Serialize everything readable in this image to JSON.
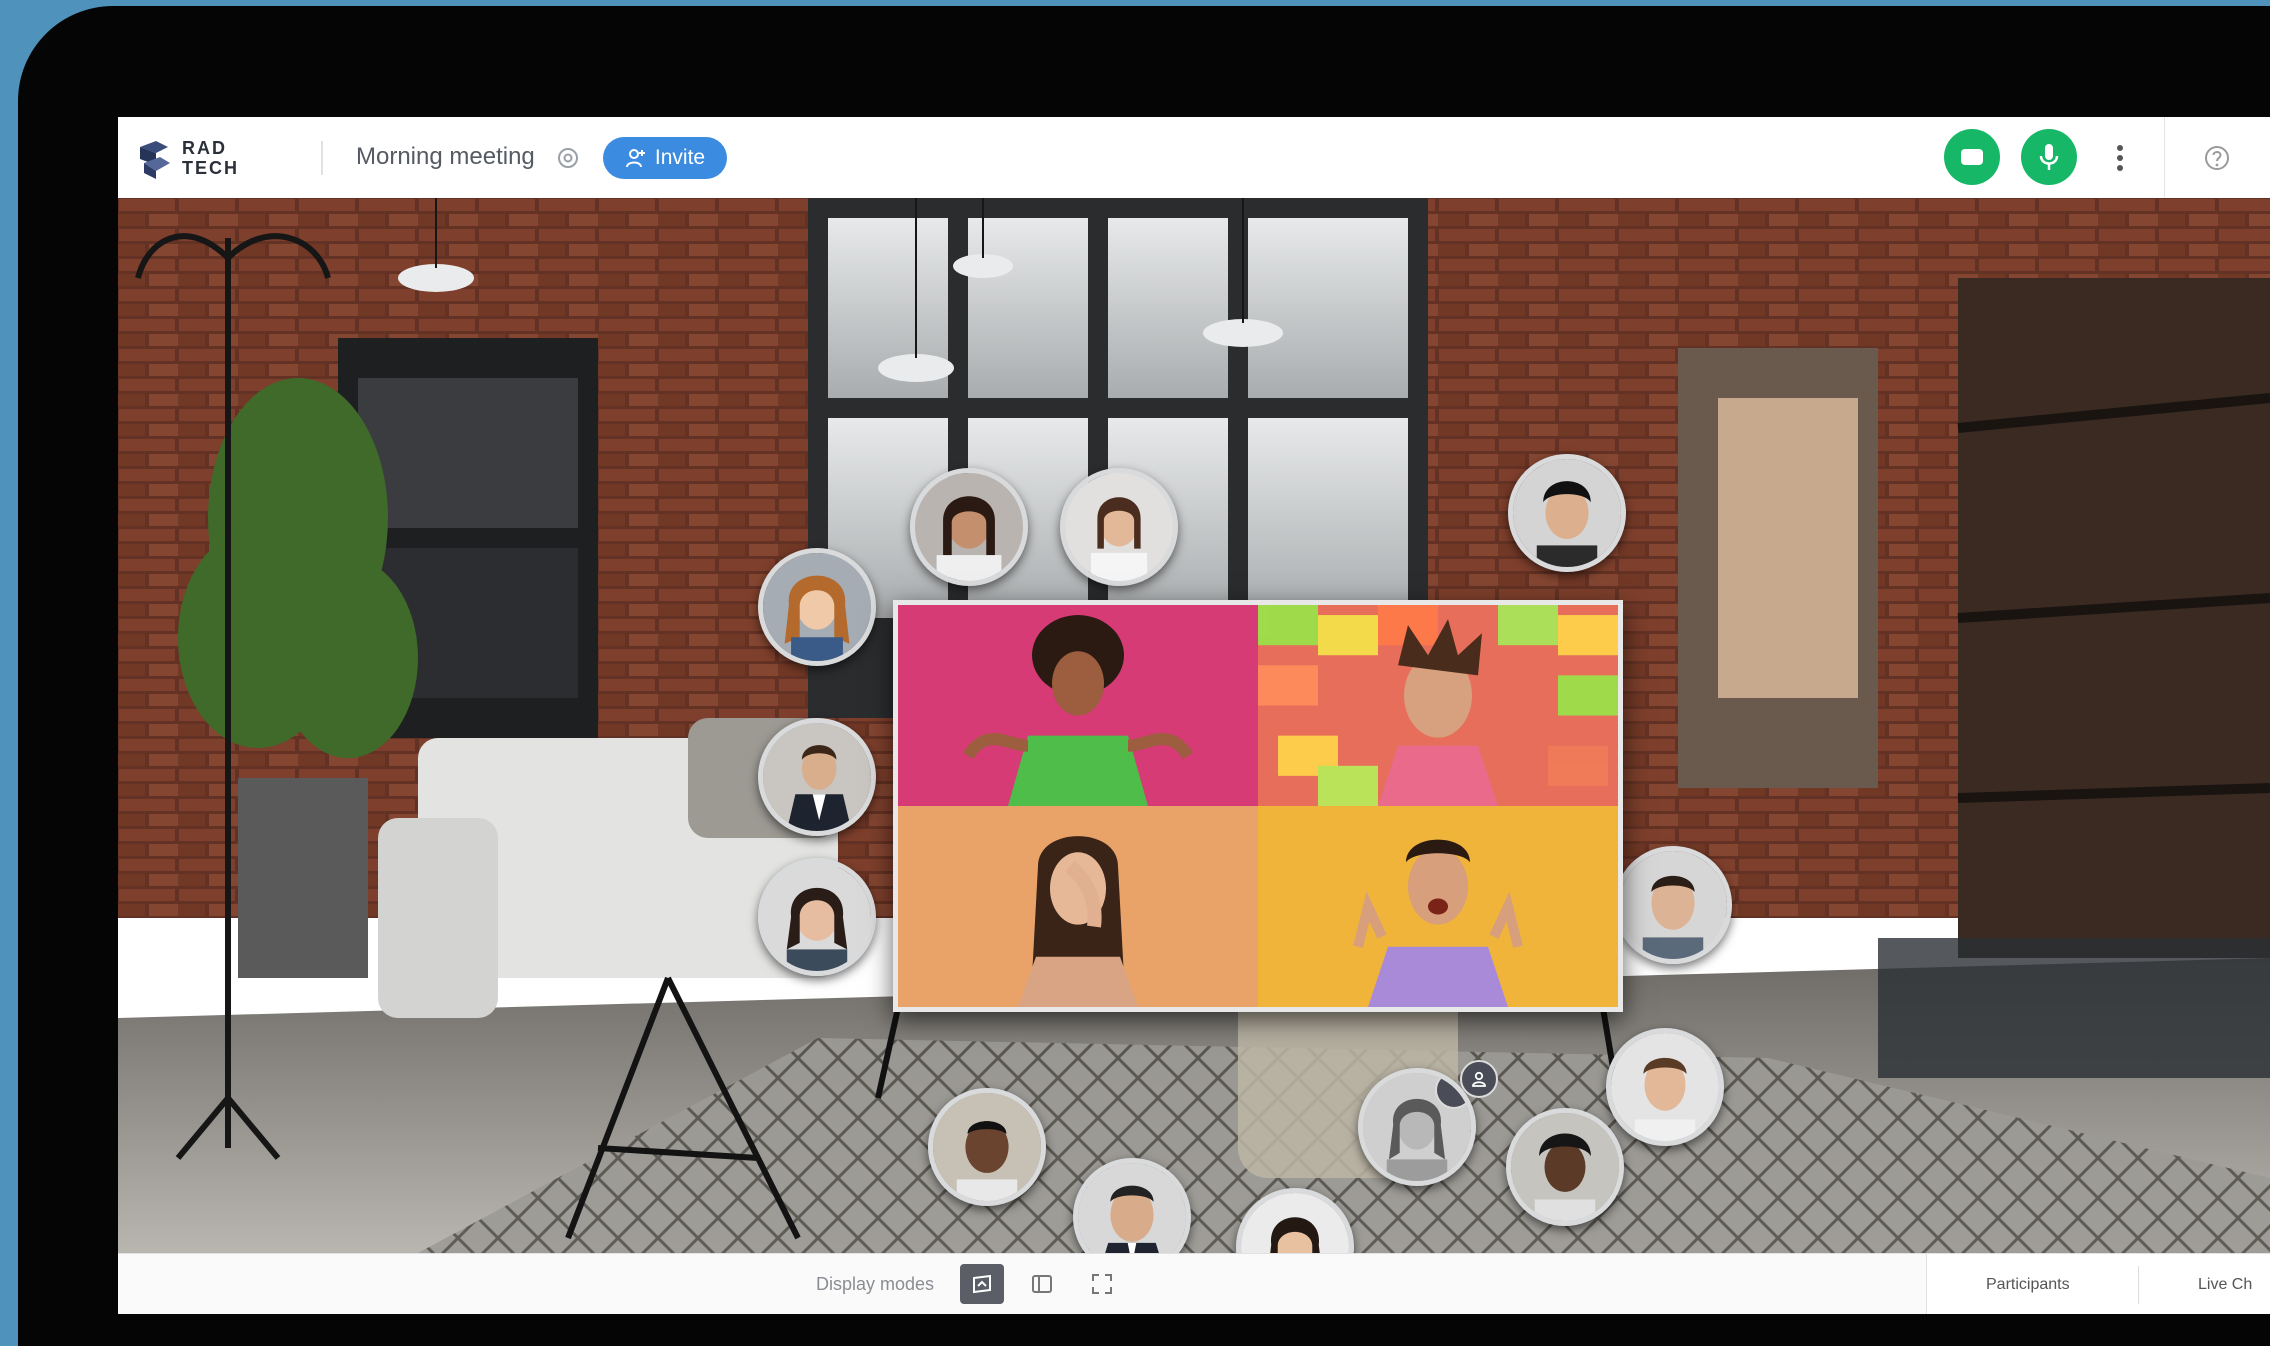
{
  "brand": {
    "line1": "RAD",
    "line2": "TECH"
  },
  "header": {
    "meeting_title": "Morning meeting",
    "invite_label": "Invite"
  },
  "bottom_bar": {
    "display_modes_label": "Display modes",
    "tabs": [
      {
        "label": "Participants"
      },
      {
        "label": "Live Ch"
      }
    ]
  },
  "colors": {
    "accent_blue": "#3b8be0",
    "active_green": "#16b868",
    "backdrop": "#4f93bd"
  },
  "icons": {
    "camera": "camera-icon",
    "microphone": "microphone-icon",
    "more": "more-vertical-icon",
    "help": "help-icon",
    "settings": "gear-icon"
  }
}
